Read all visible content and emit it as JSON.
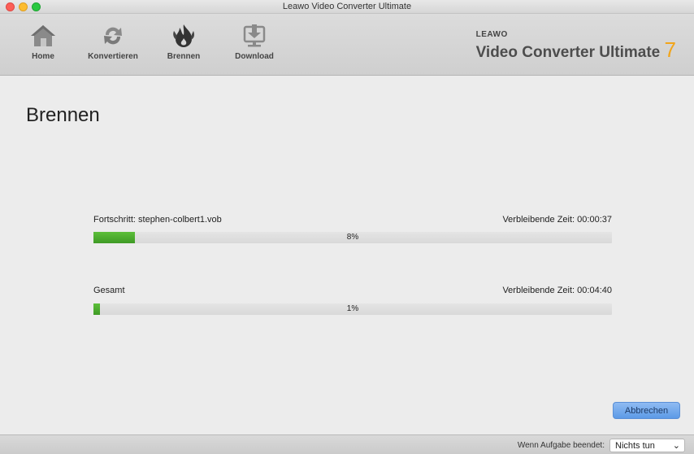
{
  "window": {
    "title": "Leawo Video Converter Ultimate"
  },
  "toolbar": {
    "items": [
      {
        "label": "Home",
        "icon": "home-icon"
      },
      {
        "label": "Konvertieren",
        "icon": "convert-icon"
      },
      {
        "label": "Brennen",
        "icon": "burn-icon"
      },
      {
        "label": "Download",
        "icon": "download-icon"
      }
    ]
  },
  "brand": {
    "small": "LEAWO",
    "big": "Video Converter Ultimate",
    "version": "7",
    "version_color": "#f2a51a"
  },
  "page": {
    "title": "Brennen"
  },
  "progress": {
    "current": {
      "label": "Fortschritt:",
      "file": "stephen-colbert1.vob",
      "time_label": "Verbleibende Zeit:",
      "time": "00:00:37",
      "percent_text": "8%",
      "fraction": 0.08
    },
    "total": {
      "label": "Gesamt",
      "time_label": "Verbleibende Zeit:",
      "time": "00:04:40",
      "percent_text": "1%",
      "fraction": 0.01
    }
  },
  "buttons": {
    "cancel": "Abbrechen"
  },
  "status": {
    "label": "Wenn Aufgabe beendet:",
    "option": "Nichts tun"
  },
  "colors": {
    "accent": "#4fae30",
    "button": "#6fa6ea"
  }
}
